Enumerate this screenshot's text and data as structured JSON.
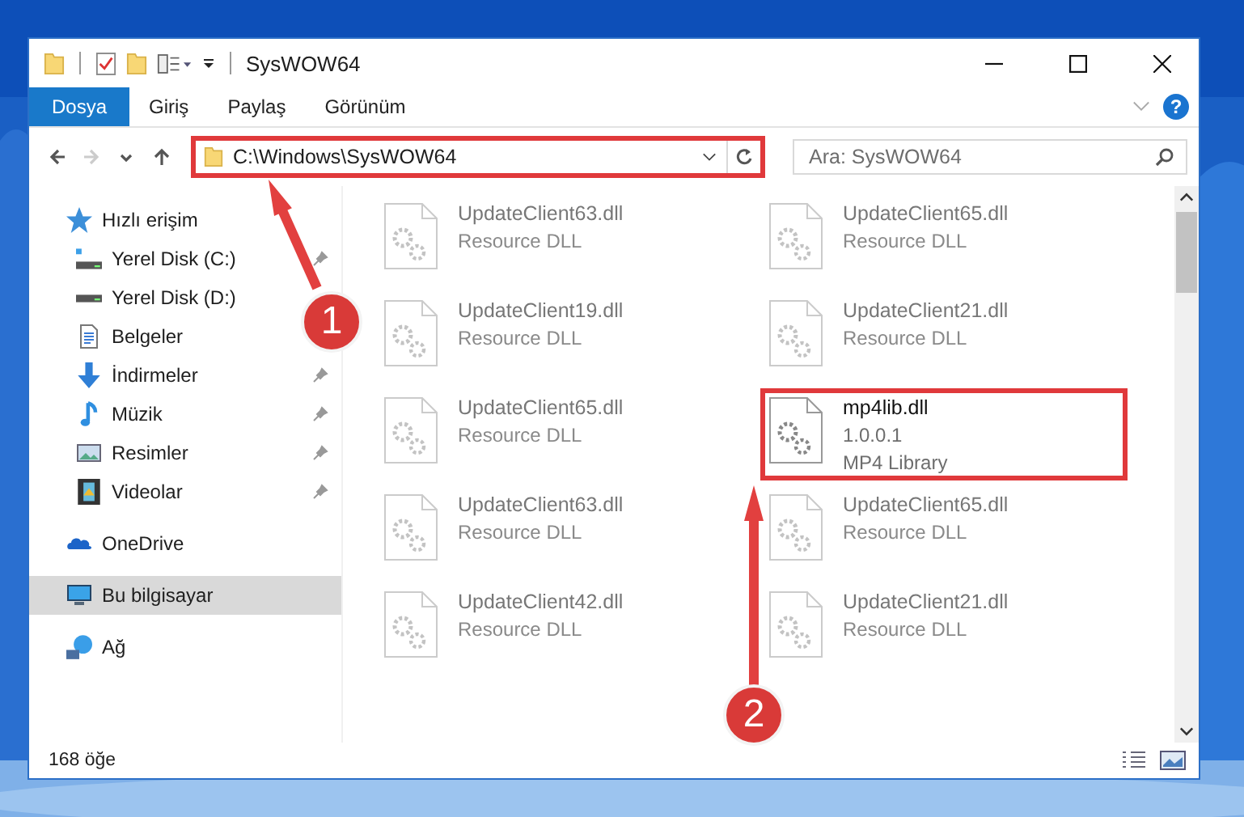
{
  "window": {
    "title": "SysWOW64"
  },
  "ribbon_tabs": [
    {
      "label": "Dosya",
      "kind": "file"
    },
    {
      "label": "Giriş",
      "kind": "tab"
    },
    {
      "label": "Paylaş",
      "kind": "tab"
    },
    {
      "label": "Görünüm",
      "kind": "tab"
    }
  ],
  "help": "?",
  "nav_buttons": [
    {
      "kind": "back",
      "disabled": false
    },
    {
      "kind": "forward",
      "disabled": true
    },
    {
      "kind": "recent",
      "disabled": false
    },
    {
      "kind": "up",
      "disabled": false
    }
  ],
  "address": {
    "path": "C:\\Windows\\SysWOW64",
    "highlighted": true
  },
  "search": {
    "placeholder": "Ara: SysWOW64"
  },
  "sidebar": {
    "items": [
      {
        "label": "Hızlı erişim",
        "kind": "star",
        "selected": false,
        "children": [
          {
            "label": "Yerel Disk (C:)",
            "kind": "drive-c",
            "pinned": true,
            "selected": false
          },
          {
            "label": "Yerel Disk (D:)",
            "kind": "drive",
            "pinned": false,
            "selected": false
          },
          {
            "label": "Belgeler",
            "kind": "document",
            "pinned": false,
            "selected": false
          },
          {
            "label": "İndirmeler",
            "kind": "download",
            "pinned": true,
            "selected": false
          },
          {
            "label": "Müzik",
            "kind": "music",
            "pinned": true,
            "selected": false
          },
          {
            "label": "Resimler",
            "kind": "pictures",
            "pinned": true,
            "selected": false
          },
          {
            "label": "Videolar",
            "kind": "video",
            "pinned": true,
            "selected": false
          }
        ]
      },
      {
        "label": "OneDrive",
        "kind": "cloud",
        "selected": false
      },
      {
        "label": "Bu bilgisayar",
        "kind": "computer",
        "selected": true
      },
      {
        "label": "Ağ",
        "kind": "network",
        "selected": false
      }
    ]
  },
  "files": [
    {
      "name": "UpdateClient63.dll",
      "lines": [
        "Resource DLL"
      ],
      "dimmed": true,
      "highlighted": false
    },
    {
      "name": "UpdateClient65.dll",
      "lines": [
        "Resource DLL"
      ],
      "dimmed": true,
      "highlighted": false
    },
    {
      "name": "UpdateClient19.dll",
      "lines": [
        "Resource DLL"
      ],
      "dimmed": true,
      "highlighted": false
    },
    {
      "name": "UpdateClient21.dll",
      "lines": [
        "Resource DLL"
      ],
      "dimmed": true,
      "highlighted": false
    },
    {
      "name": "UpdateClient65.dll",
      "lines": [
        "Resource DLL"
      ],
      "dimmed": true,
      "highlighted": false
    },
    {
      "name": "mp4lib.dll",
      "lines": [
        "1.0.0.1",
        "MP4 Library"
      ],
      "dimmed": false,
      "highlighted": true
    },
    {
      "name": "UpdateClient63.dll",
      "lines": [
        "Resource DLL"
      ],
      "dimmed": true,
      "highlighted": false
    },
    {
      "name": "UpdateClient65.dll",
      "lines": [
        "Resource DLL"
      ],
      "dimmed": true,
      "highlighted": false
    },
    {
      "name": "UpdateClient42.dll",
      "lines": [
        "Resource DLL"
      ],
      "dimmed": true,
      "highlighted": false
    },
    {
      "name": "UpdateClient21.dll",
      "lines": [
        "Resource DLL"
      ],
      "dimmed": true,
      "highlighted": false
    }
  ],
  "status_bar": {
    "count": "168 öğe"
  },
  "annotations": [
    {
      "number": "1"
    },
    {
      "number": "2"
    }
  ]
}
